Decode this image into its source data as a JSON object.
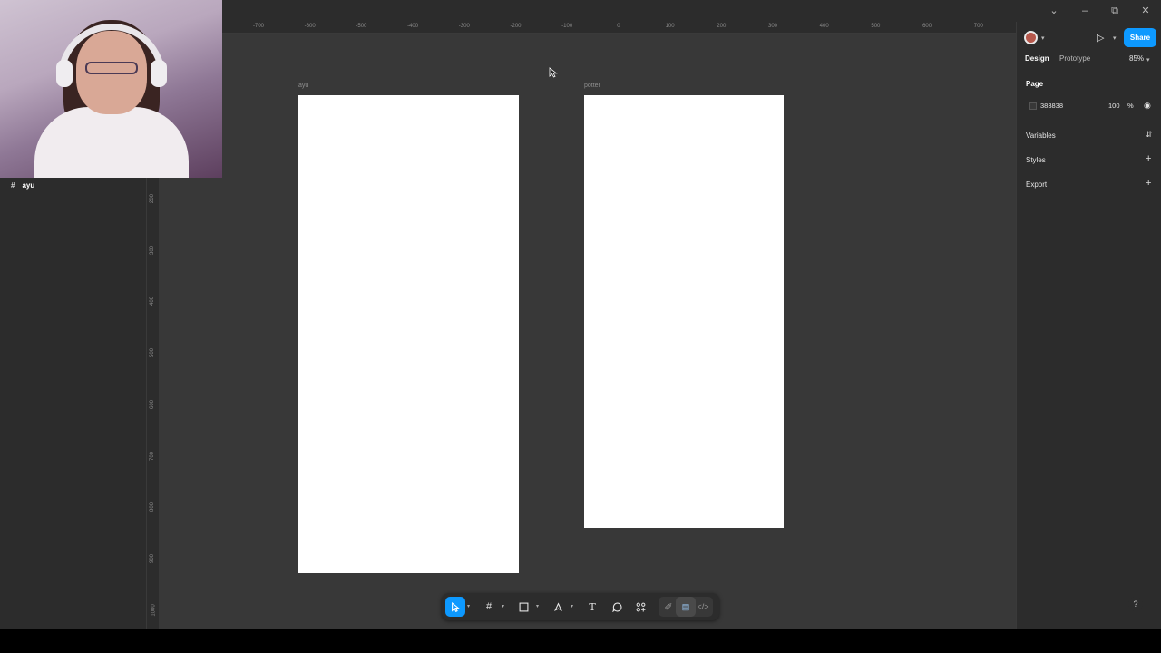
{
  "window": {
    "controls": [
      "chevron-down",
      "minimize",
      "restore",
      "close"
    ]
  },
  "ruler": {
    "top_ticks": [
      "-700",
      "-600",
      "-500",
      "-400",
      "-300",
      "-200",
      "-100",
      "0",
      "100",
      "200",
      "300",
      "400",
      "500",
      "600",
      "700"
    ],
    "left_ticks": [
      "200",
      "300",
      "400",
      "500",
      "600",
      "700",
      "800",
      "900",
      "1000"
    ]
  },
  "layers": {
    "items": [
      {
        "label": "ayu",
        "icon": "frame-icon"
      }
    ]
  },
  "canvas": {
    "background": "#383838",
    "frames": [
      {
        "label": "ayu",
        "fill": "#ffffff"
      },
      {
        "label": "potter",
        "fill": "#ffffff"
      }
    ]
  },
  "header": {
    "share_label": "Share"
  },
  "tabs": {
    "design": "Design",
    "prototype": "Prototype",
    "zoom": "85%"
  },
  "page_section": {
    "title": "Page",
    "color_hex": "383838",
    "opacity": "100",
    "opacity_unit": "%"
  },
  "sections": {
    "variables": "Variables",
    "styles": "Styles",
    "export": "Export"
  },
  "toolbar": {
    "tools": [
      "move-tool",
      "frame-tool",
      "rectangle-tool",
      "pen-tool",
      "text-tool",
      "comment-tool",
      "actions-tool"
    ],
    "modes": [
      "draw-mode",
      "design-mode",
      "dev-mode"
    ]
  },
  "help": {
    "label": "?"
  },
  "colors": {
    "accent": "#0d99ff",
    "panel": "#2c2c2c",
    "canvas": "#383838"
  }
}
